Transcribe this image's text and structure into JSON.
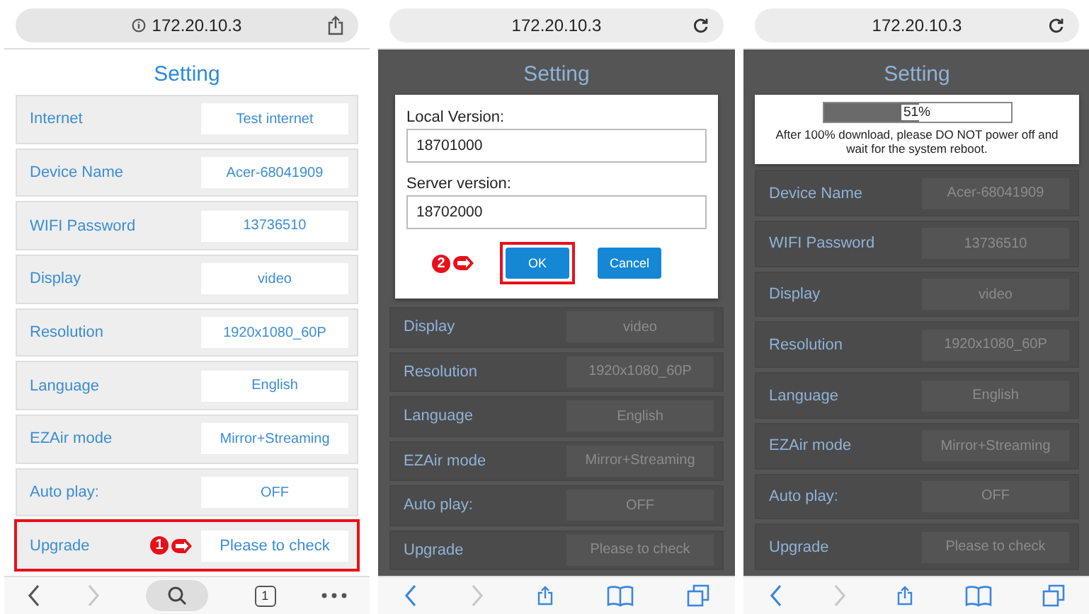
{
  "panels": [
    {
      "dimmed": false,
      "url_bar": {
        "kind": "share",
        "url": "172.20.10.3"
      },
      "title": "Setting",
      "rows": [
        {
          "label": "Internet",
          "value": "Test internet",
          "highlighted": false
        },
        {
          "label": "Device Name",
          "value": "Acer-68041909",
          "highlighted": false
        },
        {
          "label": "WIFI Password",
          "value": "13736510",
          "highlighted": false
        },
        {
          "label": "Display",
          "value": "video",
          "highlighted": false
        },
        {
          "label": "Resolution",
          "value": "1920x1080_60P",
          "highlighted": false
        },
        {
          "label": "Language",
          "value": "English",
          "highlighted": false
        },
        {
          "label": "EZAir mode",
          "value": "Mirror+Streaming",
          "highlighted": false
        },
        {
          "label": "Auto play:",
          "value": "OFF",
          "highlighted": false
        },
        {
          "label": "Upgrade",
          "value": "Please to check",
          "highlighted": true,
          "step": "1"
        }
      ],
      "toolbar": {
        "kind": "search",
        "tab_count": "1"
      }
    },
    {
      "dimmed": true,
      "url_bar": {
        "kind": "reload",
        "url": "172.20.10.3"
      },
      "title": "Setting",
      "dialog": {
        "kind": "version",
        "fields": [
          {
            "label": "Local Version:",
            "value": "18701000"
          },
          {
            "label": "Server version:",
            "value": "18702000"
          }
        ],
        "buttons": [
          {
            "label": "OK",
            "highlighted": true,
            "step": "2",
            "primary": true
          },
          {
            "label": "Cancel",
            "highlighted": false,
            "primary": true
          }
        ]
      },
      "rows": [
        {
          "label": "Display",
          "value": "video",
          "highlighted": false
        },
        {
          "label": "Resolution",
          "value": "1920x1080_60P",
          "highlighted": false
        },
        {
          "label": "Language",
          "value": "English",
          "highlighted": false
        },
        {
          "label": "EZAir mode",
          "value": "Mirror+Streaming",
          "highlighted": false
        },
        {
          "label": "Auto play:",
          "value": "OFF",
          "highlighted": false
        },
        {
          "label": "Upgrade",
          "value": "Please to check",
          "highlighted": false
        }
      ],
      "toolbar": {
        "kind": "bookmarks"
      }
    },
    {
      "dimmed": true,
      "url_bar": {
        "kind": "reload",
        "url": "172.20.10.3"
      },
      "title": "Setting",
      "dialog": {
        "kind": "progress",
        "level": 0.51,
        "percent": "51%",
        "message": "After 100% download, please DO NOT power off and wait for the system reboot."
      },
      "rows": [
        {
          "label": "Device Name",
          "value": "Acer-68041909",
          "highlighted": false
        },
        {
          "label": "WIFI Password",
          "value": "13736510",
          "highlighted": false
        },
        {
          "label": "Display",
          "value": "video",
          "highlighted": false
        },
        {
          "label": "Resolution",
          "value": "1920x1080_60P",
          "highlighted": false
        },
        {
          "label": "Language",
          "value": "English",
          "highlighted": false
        },
        {
          "label": "EZAir mode",
          "value": "Mirror+Streaming",
          "highlighted": false
        },
        {
          "label": "Auto play:",
          "value": "OFF",
          "highlighted": false
        },
        {
          "label": "Upgrade",
          "value": "Please to check",
          "highlighted": false
        }
      ],
      "toolbar": {
        "kind": "bookmarks"
      }
    }
  ]
}
